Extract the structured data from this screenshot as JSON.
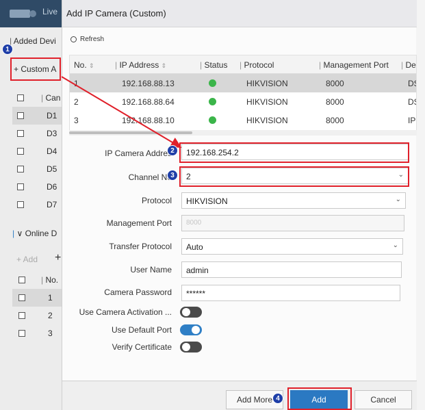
{
  "background": {
    "live_tab": "Live",
    "added_devices_tab": "Added Devi",
    "custom_add_button": "+ Custom A",
    "table_col": "Can",
    "rows": [
      "D1",
      "D3",
      "D4",
      "D5",
      "D6",
      "D7"
    ],
    "online_section": "Online D",
    "add_button": "+ Add",
    "plus_button": "+",
    "online_col": "No.",
    "online_rows": [
      "1",
      "2",
      "3"
    ]
  },
  "dialog": {
    "title": "Add IP Camera (Custom)",
    "refresh_label": "Refresh",
    "table": {
      "headers": [
        "No.",
        "IP Address",
        "Status",
        "Protocol",
        "Management Port",
        "De"
      ],
      "rows": [
        {
          "no": "1",
          "ip": "192.168.88.13",
          "protocol": "HIKVISION",
          "port": "8000",
          "device": "DS"
        },
        {
          "no": "2",
          "ip": "192.168.88.64",
          "protocol": "HIKVISION",
          "port": "8000",
          "device": "DS"
        },
        {
          "no": "3",
          "ip": "192.168.88.10",
          "protocol": "HIKVISION",
          "port": "8000",
          "device": "IP"
        }
      ]
    },
    "form": {
      "ip_label": "IP Camera Addres",
      "ip_value": "192.168.254.2",
      "channel_label": "Channel No",
      "channel_value": "2",
      "protocol_label": "Protocol",
      "protocol_value": "HIKVISION",
      "mgmt_port_label": "Management Port",
      "mgmt_port_value": "8000",
      "transfer_label": "Transfer Protocol",
      "transfer_value": "Auto",
      "user_label": "User Name",
      "user_value": "admin",
      "password_label": "Camera Password",
      "password_value": "******",
      "activation_label": "Use Camera Activation ...",
      "default_port_label": "Use Default Port",
      "verify_label": "Verify Certificate"
    },
    "toggles": {
      "activation": false,
      "default_port": true,
      "verify": false
    },
    "footer": {
      "add_more": "Add More",
      "add": "Add",
      "cancel": "Cancel"
    }
  },
  "annotations": {
    "step1": "1",
    "step2": "2",
    "step3": "3",
    "step4": "4"
  },
  "colors": {
    "highlight": "#e0202a",
    "badge": "#1f3fa8",
    "primary": "#2b79c2",
    "status_ok": "#3bb54a"
  }
}
